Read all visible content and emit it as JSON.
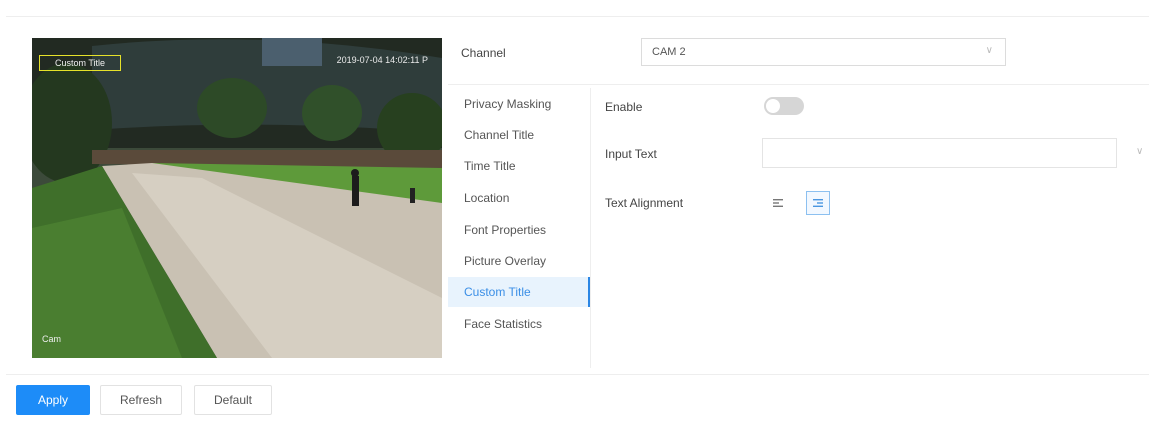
{
  "video": {
    "osd_title": "Custom Title",
    "osd_time": "2019-07-04 14:02:11 P",
    "osd_channel": "Cam"
  },
  "channel": {
    "label": "Channel",
    "value": "CAM 2"
  },
  "menu": {
    "items": [
      {
        "label": "Privacy Masking"
      },
      {
        "label": "Channel Title"
      },
      {
        "label": "Time Title"
      },
      {
        "label": "Location"
      },
      {
        "label": "Font Properties"
      },
      {
        "label": "Picture Overlay"
      },
      {
        "label": "Custom Title",
        "active": true
      },
      {
        "label": "Face Statistics"
      }
    ]
  },
  "form": {
    "enable_label": "Enable",
    "enable_value": false,
    "input_text_label": "Input Text",
    "input_text_value": "",
    "alignment_label": "Text Alignment",
    "alignment_selected": "right"
  },
  "buttons": {
    "apply": "Apply",
    "refresh": "Refresh",
    "default": "Default"
  },
  "colors": {
    "accent": "#1d8cf8",
    "active_menu_bg": "#e8f3fd"
  }
}
